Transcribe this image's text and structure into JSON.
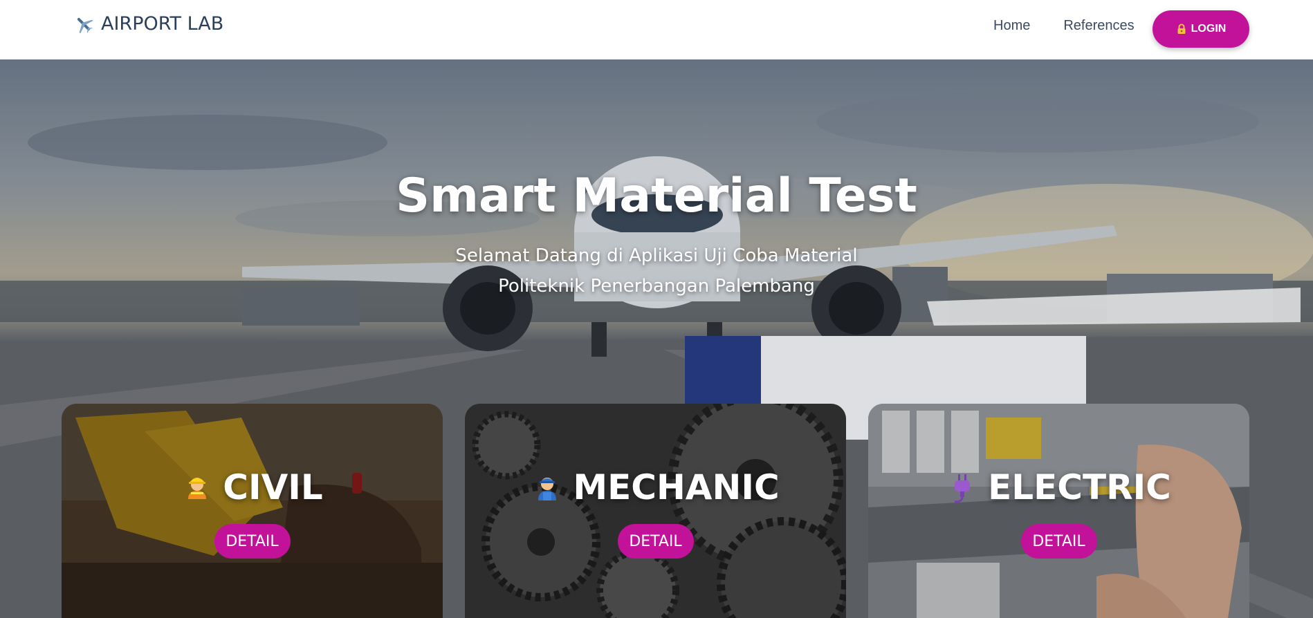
{
  "brand": {
    "name": "AIRPORT LAB",
    "icon": "airplane-icon"
  },
  "nav": {
    "links": [
      {
        "label": "Home"
      },
      {
        "label": "References"
      }
    ],
    "login_label": "LOGIN",
    "login_icon": "lock-icon"
  },
  "hero": {
    "title": "Smart Material Test",
    "subtitle_line1": "Selamat Datang di Aplikasi Uji Coba Material",
    "subtitle_line2": "Politeknik Penerbangan Palembang"
  },
  "cards": [
    {
      "title": "CIVIL",
      "icon": "construction-worker-icon",
      "button": "DETAIL"
    },
    {
      "title": "MECHANIC",
      "icon": "mechanic-icon",
      "button": "DETAIL"
    },
    {
      "title": "ELECTRIC",
      "icon": "electric-plug-icon",
      "button": "DETAIL"
    }
  ],
  "colors": {
    "accent": "#c2129a",
    "brand_text": "#2b3f5c",
    "nav_text": "#3a4a63"
  }
}
